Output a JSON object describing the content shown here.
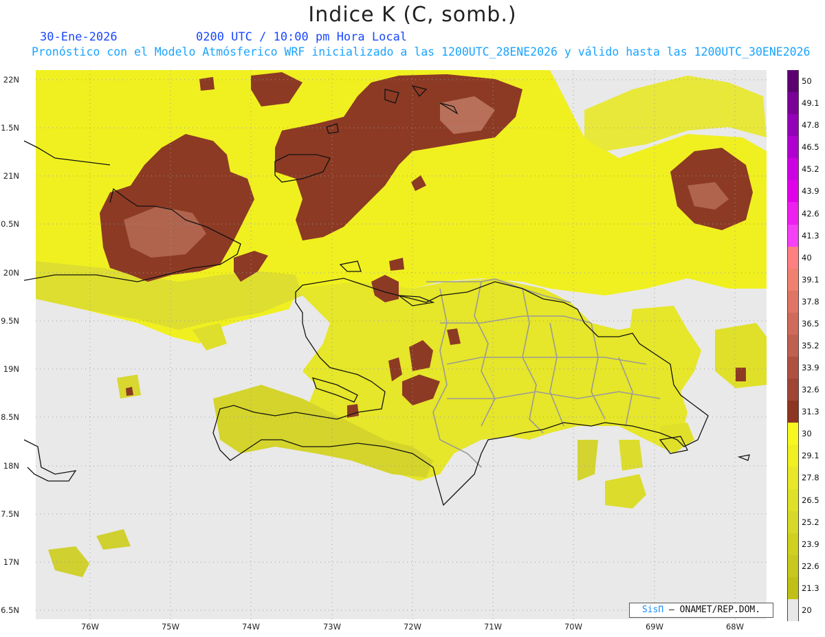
{
  "title": "Indice K (C, somb.)",
  "date": "30-Ene-2026",
  "time": "0200 UTC / 10:00 pm Hora Local",
  "model_line": "Pronóstico con el Modelo Atmósferico WRF inicializado a las 1200UTC_28ENE2026 y válido hasta las  1200UTC_30ENE2026",
  "y_ticks": [
    "22N",
    "1.5N",
    "21N",
    "0.5N",
    "20N",
    "9.5N",
    "19N",
    "8.5N",
    "18N",
    "7.5N",
    "17N",
    "6.5N"
  ],
  "x_ticks": [
    "76W",
    "75W",
    "74W",
    "73W",
    "72W",
    "71W",
    "70W",
    "69W",
    "68W"
  ],
  "colorbar": {
    "labels": [
      "50",
      "49.1",
      "47.8",
      "46.5",
      "45.2",
      "43.9",
      "42.6",
      "41.3",
      "40",
      "39.1",
      "37.8",
      "36.5",
      "35.2",
      "33.9",
      "32.6",
      "31.3",
      "30",
      "29.1",
      "27.8",
      "26.5",
      "25.2",
      "23.9",
      "22.6",
      "21.3",
      "20"
    ],
    "colors": [
      "#5c0070",
      "#7a0096",
      "#9400b8",
      "#b000d0",
      "#cc00e0",
      "#e000ea",
      "#ee20f0",
      "#f540f5",
      "#ff8080",
      "#f08070",
      "#e07565",
      "#d06a5a",
      "#c06050",
      "#b05040",
      "#a04535",
      "#8c3520",
      "#f8f820",
      "#f0f020",
      "#e8e828",
      "#e0e028",
      "#d8d828",
      "#d0d020",
      "#c8c820",
      "#c0c018",
      "#e8e8e8"
    ]
  },
  "colors": {
    "land_fill": "#ebeb20",
    "land_dark": "#cccc22",
    "high_k": "#8c3a24",
    "high_k_light": "#b0644e",
    "background": "#e9e9e9",
    "coast": "#111111",
    "border": "#9a9a9a"
  },
  "credit": {
    "brand": "SisΠ",
    "org": " – ONAMET/REP.DOM."
  }
}
